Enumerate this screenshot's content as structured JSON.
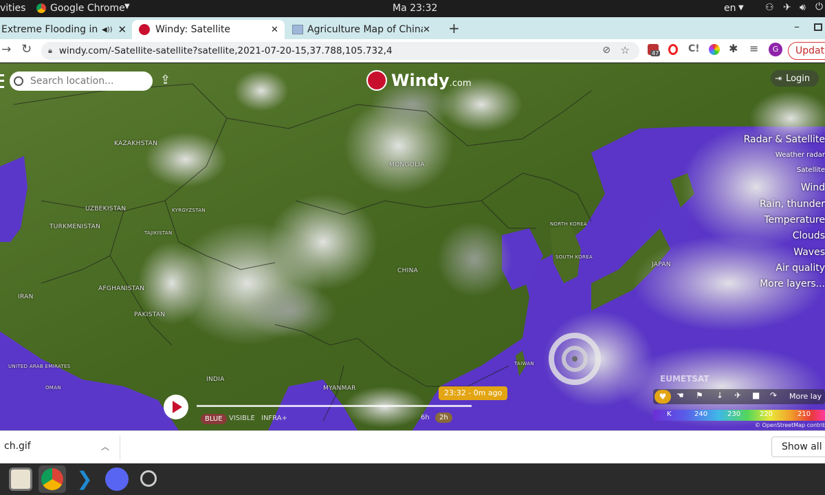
{
  "system_bar": {
    "activities": "vities",
    "app_name": "Google Chrome",
    "clock": "Ma 23:32",
    "language": "en"
  },
  "tabs": [
    {
      "title": "Extreme Flooding in Zh",
      "active": false
    },
    {
      "title": "Windy: Satellite",
      "active": true
    },
    {
      "title": "Agriculture Map of China,",
      "active": false
    }
  ],
  "toolbar": {
    "url": "windy.com/-Satellite-satellite?satellite,2021-07-20-15,37.788,105.732,4",
    "extension_badge": "47",
    "profile_initial": "G",
    "update_label": "Update"
  },
  "map": {
    "search_placeholder": "Search location...",
    "logo_text": "Windy",
    "logo_suffix": ".com",
    "login_label": "Login",
    "country_labels": {
      "kazakhstan": "KAZAKHSTAN",
      "uzbekistan": "UZBEKISTAN",
      "turkmenistan": "TURKMENISTAN",
      "afghanistan": "AFGHANISTAN",
      "iran": "IRAN",
      "pakistan": "PAKISTAN",
      "mongolia": "MONGOLIA",
      "china": "CHINA",
      "north_korea": "NORTH KOREA",
      "south_korea": "SOUTH KOREA",
      "japan": "JAPAN",
      "india": "INDIA",
      "myanmar": "MYANMAR",
      "taiwan": "TAIWAN",
      "oman": "OMAN",
      "uae": "UNITED ARAB EMIRATES",
      "kyrgyzstan": "KYRGYZSTAN",
      "tajikistan": "TAJIKISTAN"
    },
    "layers_menu": {
      "header": "Radar & Satellite",
      "sub1": "Weather radar",
      "sub2": "Satellite",
      "items": [
        "Wind",
        "Rain, thunder",
        "Temperature",
        "Clouds",
        "Waves",
        "Air quality",
        "More layers..."
      ]
    },
    "timeline": {
      "time_label": "23:32 - 0m ago",
      "channels": [
        "BLUE",
        "VISIBLE",
        "INFRA+"
      ],
      "step_2h": "2h",
      "step_6h": "6h"
    },
    "watermark": "EUMETSAT",
    "more_layers_short": "More lay",
    "legend": {
      "unit": "K",
      "ticks": [
        "240",
        "230",
        "220",
        "210"
      ]
    },
    "attribution": "© OpenStreetMap contributors"
  },
  "download_bar": {
    "filename": "ch.gif",
    "show_all_label": "Show all"
  }
}
